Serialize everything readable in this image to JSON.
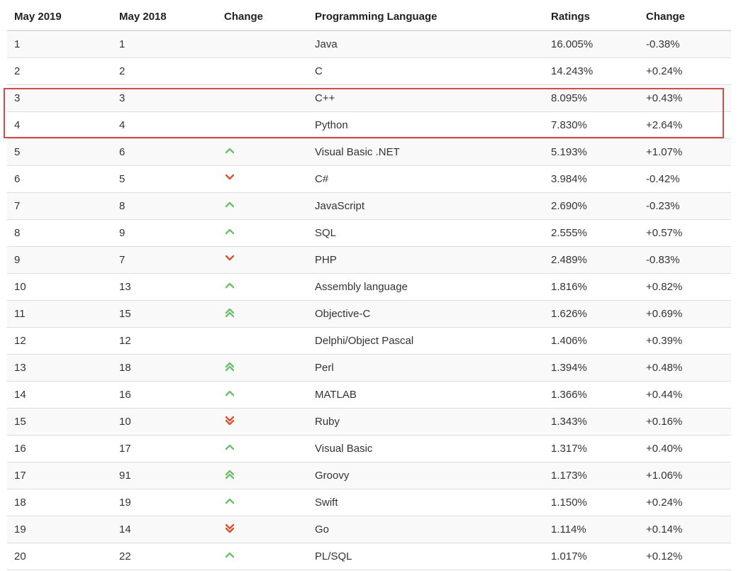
{
  "colors": {
    "up": "#6cbf6c",
    "down": "#d9522c",
    "highlight": "#d44a4a"
  },
  "header": {
    "col1": "May 2019",
    "col2": "May 2018",
    "col3": "Change",
    "col4": "Programming Language",
    "col5": "Ratings",
    "col6": "Change"
  },
  "highlight_rows": [
    3,
    4
  ],
  "rows": [
    {
      "may2019": "1",
      "may2018": "1",
      "change_icon": "none",
      "language": "Java",
      "rating": "16.005%",
      "change": "-0.38%"
    },
    {
      "may2019": "2",
      "may2018": "2",
      "change_icon": "none",
      "language": "C",
      "rating": "14.243%",
      "change": "+0.24%"
    },
    {
      "may2019": "3",
      "may2018": "3",
      "change_icon": "none",
      "language": "C++",
      "rating": "8.095%",
      "change": "+0.43%"
    },
    {
      "may2019": "4",
      "may2018": "4",
      "change_icon": "none",
      "language": "Python",
      "rating": "7.830%",
      "change": "+2.64%"
    },
    {
      "may2019": "5",
      "may2018": "6",
      "change_icon": "up",
      "language": "Visual Basic .NET",
      "rating": "5.193%",
      "change": "+1.07%"
    },
    {
      "may2019": "6",
      "may2018": "5",
      "change_icon": "down",
      "language": "C#",
      "rating": "3.984%",
      "change": "-0.42%"
    },
    {
      "may2019": "7",
      "may2018": "8",
      "change_icon": "up",
      "language": "JavaScript",
      "rating": "2.690%",
      "change": "-0.23%"
    },
    {
      "may2019": "8",
      "may2018": "9",
      "change_icon": "up",
      "language": "SQL",
      "rating": "2.555%",
      "change": "+0.57%"
    },
    {
      "may2019": "9",
      "may2018": "7",
      "change_icon": "down",
      "language": "PHP",
      "rating": "2.489%",
      "change": "-0.83%"
    },
    {
      "may2019": "10",
      "may2018": "13",
      "change_icon": "up",
      "language": "Assembly language",
      "rating": "1.816%",
      "change": "+0.82%"
    },
    {
      "may2019": "11",
      "may2018": "15",
      "change_icon": "double-up",
      "language": "Objective-C",
      "rating": "1.626%",
      "change": "+0.69%"
    },
    {
      "may2019": "12",
      "may2018": "12",
      "change_icon": "none",
      "language": "Delphi/Object Pascal",
      "rating": "1.406%",
      "change": "+0.39%"
    },
    {
      "may2019": "13",
      "may2018": "18",
      "change_icon": "double-up",
      "language": "Perl",
      "rating": "1.394%",
      "change": "+0.48%"
    },
    {
      "may2019": "14",
      "may2018": "16",
      "change_icon": "up",
      "language": "MATLAB",
      "rating": "1.366%",
      "change": "+0.44%"
    },
    {
      "may2019": "15",
      "may2018": "10",
      "change_icon": "double-down",
      "language": "Ruby",
      "rating": "1.343%",
      "change": "+0.16%"
    },
    {
      "may2019": "16",
      "may2018": "17",
      "change_icon": "up",
      "language": "Visual Basic",
      "rating": "1.317%",
      "change": "+0.40%"
    },
    {
      "may2019": "17",
      "may2018": "91",
      "change_icon": "double-up",
      "language": "Groovy",
      "rating": "1.173%",
      "change": "+1.06%"
    },
    {
      "may2019": "18",
      "may2018": "19",
      "change_icon": "up",
      "language": "Swift",
      "rating": "1.150%",
      "change": "+0.24%"
    },
    {
      "may2019": "19",
      "may2018": "14",
      "change_icon": "double-down",
      "language": "Go",
      "rating": "1.114%",
      "change": "+0.14%"
    },
    {
      "may2019": "20",
      "may2018": "22",
      "change_icon": "up",
      "language": "PL/SQL",
      "rating": "1.017%",
      "change": "+0.12%"
    }
  ]
}
